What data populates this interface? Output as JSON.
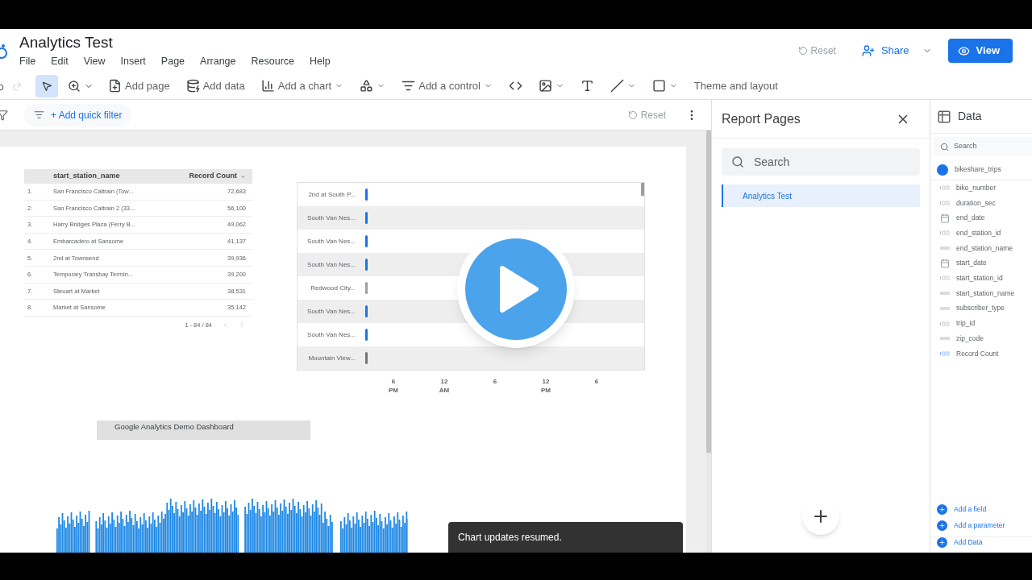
{
  "header": {
    "title": "Analytics Test",
    "menu": [
      "File",
      "Edit",
      "View",
      "Insert",
      "Page",
      "Arrange",
      "Resource",
      "Help"
    ],
    "reset": {
      "label": "Reset",
      "disabled": true
    },
    "share": "Share",
    "view": "View"
  },
  "toolbar": [
    {
      "kind": "select",
      "selected": true
    },
    {
      "kind": "zoom"
    },
    {
      "kind": "page",
      "label": "Add page"
    },
    {
      "kind": "data",
      "label": "Add data"
    },
    {
      "kind": "chart",
      "label": "Add a chart",
      "caret": true
    },
    {
      "kind": "shapes",
      "caret": true
    },
    {
      "kind": "control",
      "label": "Add a control",
      "caret": true
    },
    {
      "kind": "code"
    },
    {
      "kind": "image",
      "caret": true
    },
    {
      "kind": "text"
    },
    {
      "kind": "line",
      "caret": true
    },
    {
      "kind": "rect",
      "caret": true
    },
    {
      "kind": "theme",
      "label": "Theme and layout"
    }
  ],
  "filter_bar": {
    "add_filter": "+ Add quick filter",
    "reset": {
      "label": "Reset",
      "disabled": true
    }
  },
  "table": {
    "columns": [
      "",
      "start_station_name",
      "Record Count"
    ],
    "rows": [
      [
        "1.",
        "San Francisco Caltrain (Tow...",
        "72,683"
      ],
      [
        "2.",
        "San Francisco Caltrain 2 (33...",
        "56,100"
      ],
      [
        "3.",
        "Harry Bridges Plaza (Ferry B...",
        "49,062"
      ],
      [
        "4.",
        "Embarcadero at Sansome",
        "41,137"
      ],
      [
        "5.",
        "2nd at Townsend",
        "39,936"
      ],
      [
        "6.",
        "Temporary Transbay Termin...",
        "39,200"
      ],
      [
        "7.",
        "Steuart at Market",
        "38,531"
      ],
      [
        "8.",
        "Market at Sansome",
        "35,142"
      ]
    ],
    "pagination": "1 - 84 / 84"
  },
  "timeline": {
    "rows": [
      {
        "label": "2nd at South P...",
        "color": "#1a73e8"
      },
      {
        "label": "South Van Nes...",
        "color": "#1a73e8"
      },
      {
        "label": "South Van Nes...",
        "color": "#1a73e8"
      },
      {
        "label": "South Van Nes...",
        "color": "#1a73e8"
      },
      {
        "label": "Redwood City...",
        "color": "#9e9e9e"
      },
      {
        "label": "South Van Nes...",
        "color": "#1a73e8"
      },
      {
        "label": "South Van Nes...",
        "color": "#1a73e8"
      },
      {
        "label": "Mountain View...",
        "color": "#757575"
      }
    ],
    "ticks": [
      {
        "value": "6",
        "period": "PM"
      },
      {
        "value": "12",
        "period": "AM"
      },
      {
        "value": "6"
      },
      {
        "value": "12",
        "period": "PM"
      },
      {
        "value": "6"
      }
    ]
  },
  "text_box": "Google Analytics Demo Dashboard",
  "toast": "Chart updates resumed.",
  "report_pages": {
    "title": "Report Pages",
    "search": {
      "placeholder": "Search"
    },
    "pages": [
      {
        "label": "Analytics Test",
        "selected": true
      }
    ]
  },
  "data_panel": {
    "title": "Data",
    "search": {
      "placeholder": "Search"
    },
    "source": "bikeshare_trips",
    "fields": [
      {
        "name": "bike_number",
        "kind": "number"
      },
      {
        "name": "duration_sec",
        "kind": "number"
      },
      {
        "name": "end_date",
        "kind": "date"
      },
      {
        "name": "end_station_id",
        "kind": "number"
      },
      {
        "name": "end_station_name",
        "kind": "text"
      },
      {
        "name": "start_date",
        "kind": "date"
      },
      {
        "name": "start_station_id",
        "kind": "number"
      },
      {
        "name": "start_station_name",
        "kind": "text"
      },
      {
        "name": "subscriber_type",
        "kind": "text"
      },
      {
        "name": "trip_id",
        "kind": "number"
      },
      {
        "name": "zip_code",
        "kind": "text"
      },
      {
        "name": "Record Count",
        "kind": "metric"
      }
    ],
    "actions": [
      "Add a field",
      "Add a parameter",
      "Add Data"
    ]
  }
}
